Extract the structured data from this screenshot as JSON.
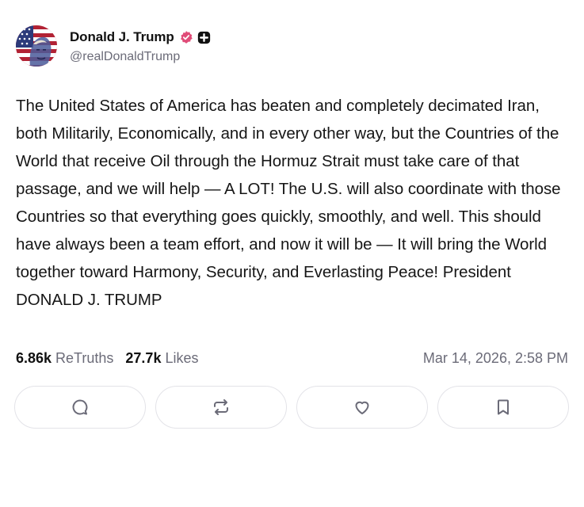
{
  "author": {
    "display_name": "Donald J. Trump",
    "handle": "@realDonaldTrump",
    "avatar_icon": "flag-portrait-avatar",
    "verified_icon": "verified-badge-icon",
    "verified_color": "#e04c78",
    "plus_icon": "truth-plus-icon"
  },
  "post": {
    "text": "The United States of America has beaten and completely decimated Iran, both Militarily, Economically, and in every other way, but the Countries of the World that receive Oil through the Hormuz Strait must take care of that passage, and we will help — A LOT! The U.S. will also coordinate with those Countries so that everything goes quickly, smoothly, and well. This should have always been a team effort, and now it will be — It will bring the World together toward Harmony, Security, and Everlasting Peace! President DONALD J. TRUMP"
  },
  "stats": {
    "retruths_count": "6.86k",
    "retruths_label": "ReTruths",
    "likes_count": "27.7k",
    "likes_label": "Likes",
    "timestamp": "Mar 14, 2026, 2:58 PM"
  },
  "actions": [
    {
      "name": "reply",
      "icon": "comment-icon"
    },
    {
      "name": "retruth",
      "icon": "repost-icon"
    },
    {
      "name": "like",
      "icon": "heart-icon"
    },
    {
      "name": "bookmark",
      "icon": "bookmark-icon"
    }
  ],
  "colors": {
    "text": "#161616",
    "muted": "#6b6b78",
    "border": "#e3e3e8",
    "icon": "#6b6b78"
  }
}
